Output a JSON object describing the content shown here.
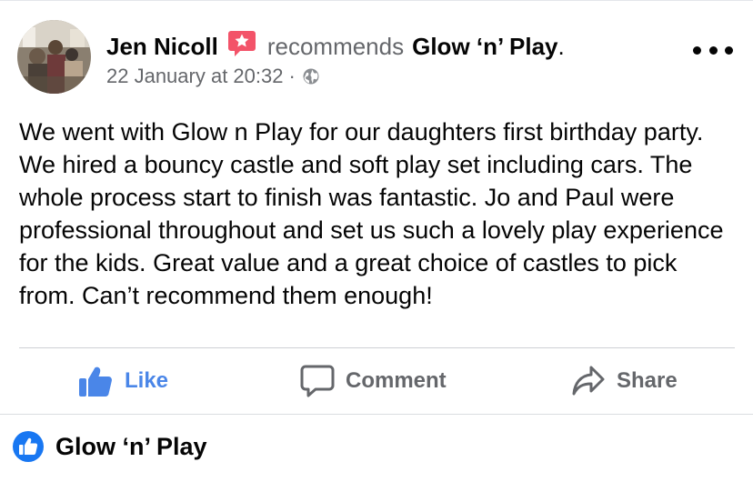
{
  "post": {
    "author": "Jen Nicoll",
    "action_text": "recommends",
    "page_name": "Glow ‘n’ Play",
    "period": ".",
    "timestamp": "22 January at 20:32",
    "separator": "·",
    "privacy_icon": "globe-icon",
    "recommend_icon": "recommend-star-icon",
    "more_icon": "more-options-icon",
    "body": "We went with Glow n Play for our daughters first birthday party. We hired a bouncy castle and soft play set including cars. The whole process start to finish was fantastic. Jo and Paul were professional throughout and set us such a lovely play experience for the kids. Great value and a great choice of castles to pick from. Can’t recommend them enough!"
  },
  "actions": {
    "like": {
      "label": "Like",
      "icon": "thumbs-up-icon"
    },
    "comment": {
      "label": "Comment",
      "icon": "comment-bubble-icon"
    },
    "share": {
      "label": "Share",
      "icon": "share-arrow-icon"
    }
  },
  "footer": {
    "icon": "like-badge-icon",
    "name": "Glow ‘n’ Play"
  },
  "colors": {
    "like_blue": "#4a86e8",
    "secondary_text": "#65676b",
    "primary_text": "#050505",
    "recommend_red": "#f35369",
    "divider": "#ced0d4",
    "footer_blue": "#1877f2"
  }
}
